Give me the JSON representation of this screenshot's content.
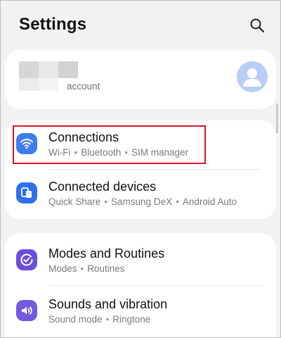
{
  "header": {
    "title": "Settings",
    "search_icon": "search-icon"
  },
  "account": {
    "label": "account",
    "avatar_icon": "person-icon"
  },
  "groups": [
    {
      "items": [
        {
          "title": "Connections",
          "subtitles": [
            "Wi-Fi",
            "Bluetooth",
            "SIM manager"
          ],
          "icon": "wifi-icon",
          "icon_color": "#3e7cf0",
          "highlighted": true
        },
        {
          "title": "Connected devices",
          "subtitles": [
            "Quick Share",
            "Samsung DeX",
            "Android Auto"
          ],
          "icon": "connected-devices-icon",
          "icon_color": "#2f6fea"
        }
      ]
    },
    {
      "items": [
        {
          "title": "Modes and Routines",
          "subtitles": [
            "Modes",
            "Routines"
          ],
          "icon": "modes-routines-icon",
          "icon_color": "#6a4fd9"
        },
        {
          "title": "Sounds and vibration",
          "subtitles": [
            "Sound mode",
            "Ringtone"
          ],
          "icon": "sound-icon",
          "icon_color": "#7358e0"
        }
      ]
    }
  ],
  "separator": "•",
  "highlight_color": "#e0102a"
}
